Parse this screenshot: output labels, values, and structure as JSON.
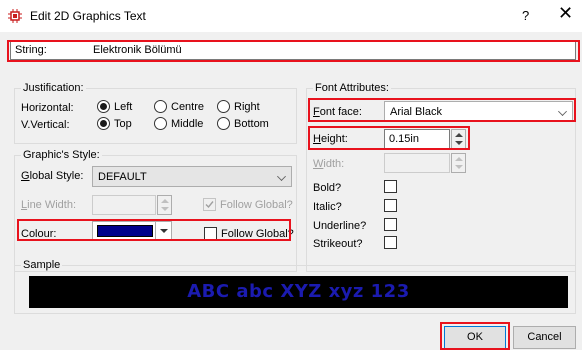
{
  "window": {
    "title": "Edit 2D Graphics Text",
    "help_glyph": "?",
    "close_glyph": "✕",
    "icon": "chip-icon"
  },
  "string": {
    "label": "String:",
    "value": "Elektronik Bölümü"
  },
  "justification": {
    "group_label": "Justification:",
    "horizontal_label": "Horizontal:",
    "vertical_label": "V.Vertical:",
    "h_options": [
      "Left",
      "Centre",
      "Right"
    ],
    "h_selected": "Left",
    "v_options": [
      "Top",
      "Middle",
      "Bottom"
    ],
    "v_selected": "Top"
  },
  "style": {
    "group_label": "Graphic's Style:",
    "global_style_label": "Global Style:",
    "global_style_value": "DEFAULT",
    "line_width_label": "Line Width:",
    "line_width_follow_label": "Follow Global?",
    "line_width_follow_checked": true,
    "colour_label": "Colour:",
    "colour_value": "#00008b",
    "colour_follow_label": "Follow Global?",
    "colour_follow_checked": false
  },
  "font": {
    "group_label": "Font Attributes:",
    "face_label": "Font face:",
    "face_value": "Arial Black",
    "height_label": "Height:",
    "height_value": "0.15in",
    "width_label": "Width:",
    "bold_label": "Bold?",
    "italic_label": "Italic?",
    "underline_label": "Underline?",
    "strikeout_label": "Strikeout?"
  },
  "sample": {
    "group_label": "Sample",
    "text": "ABC abc XYZ xyz 123",
    "text_color": "#1b1bb0",
    "background": "#000000"
  },
  "buttons": {
    "ok": "OK",
    "cancel": "Cancel"
  },
  "highlight_color": "#e8121d"
}
